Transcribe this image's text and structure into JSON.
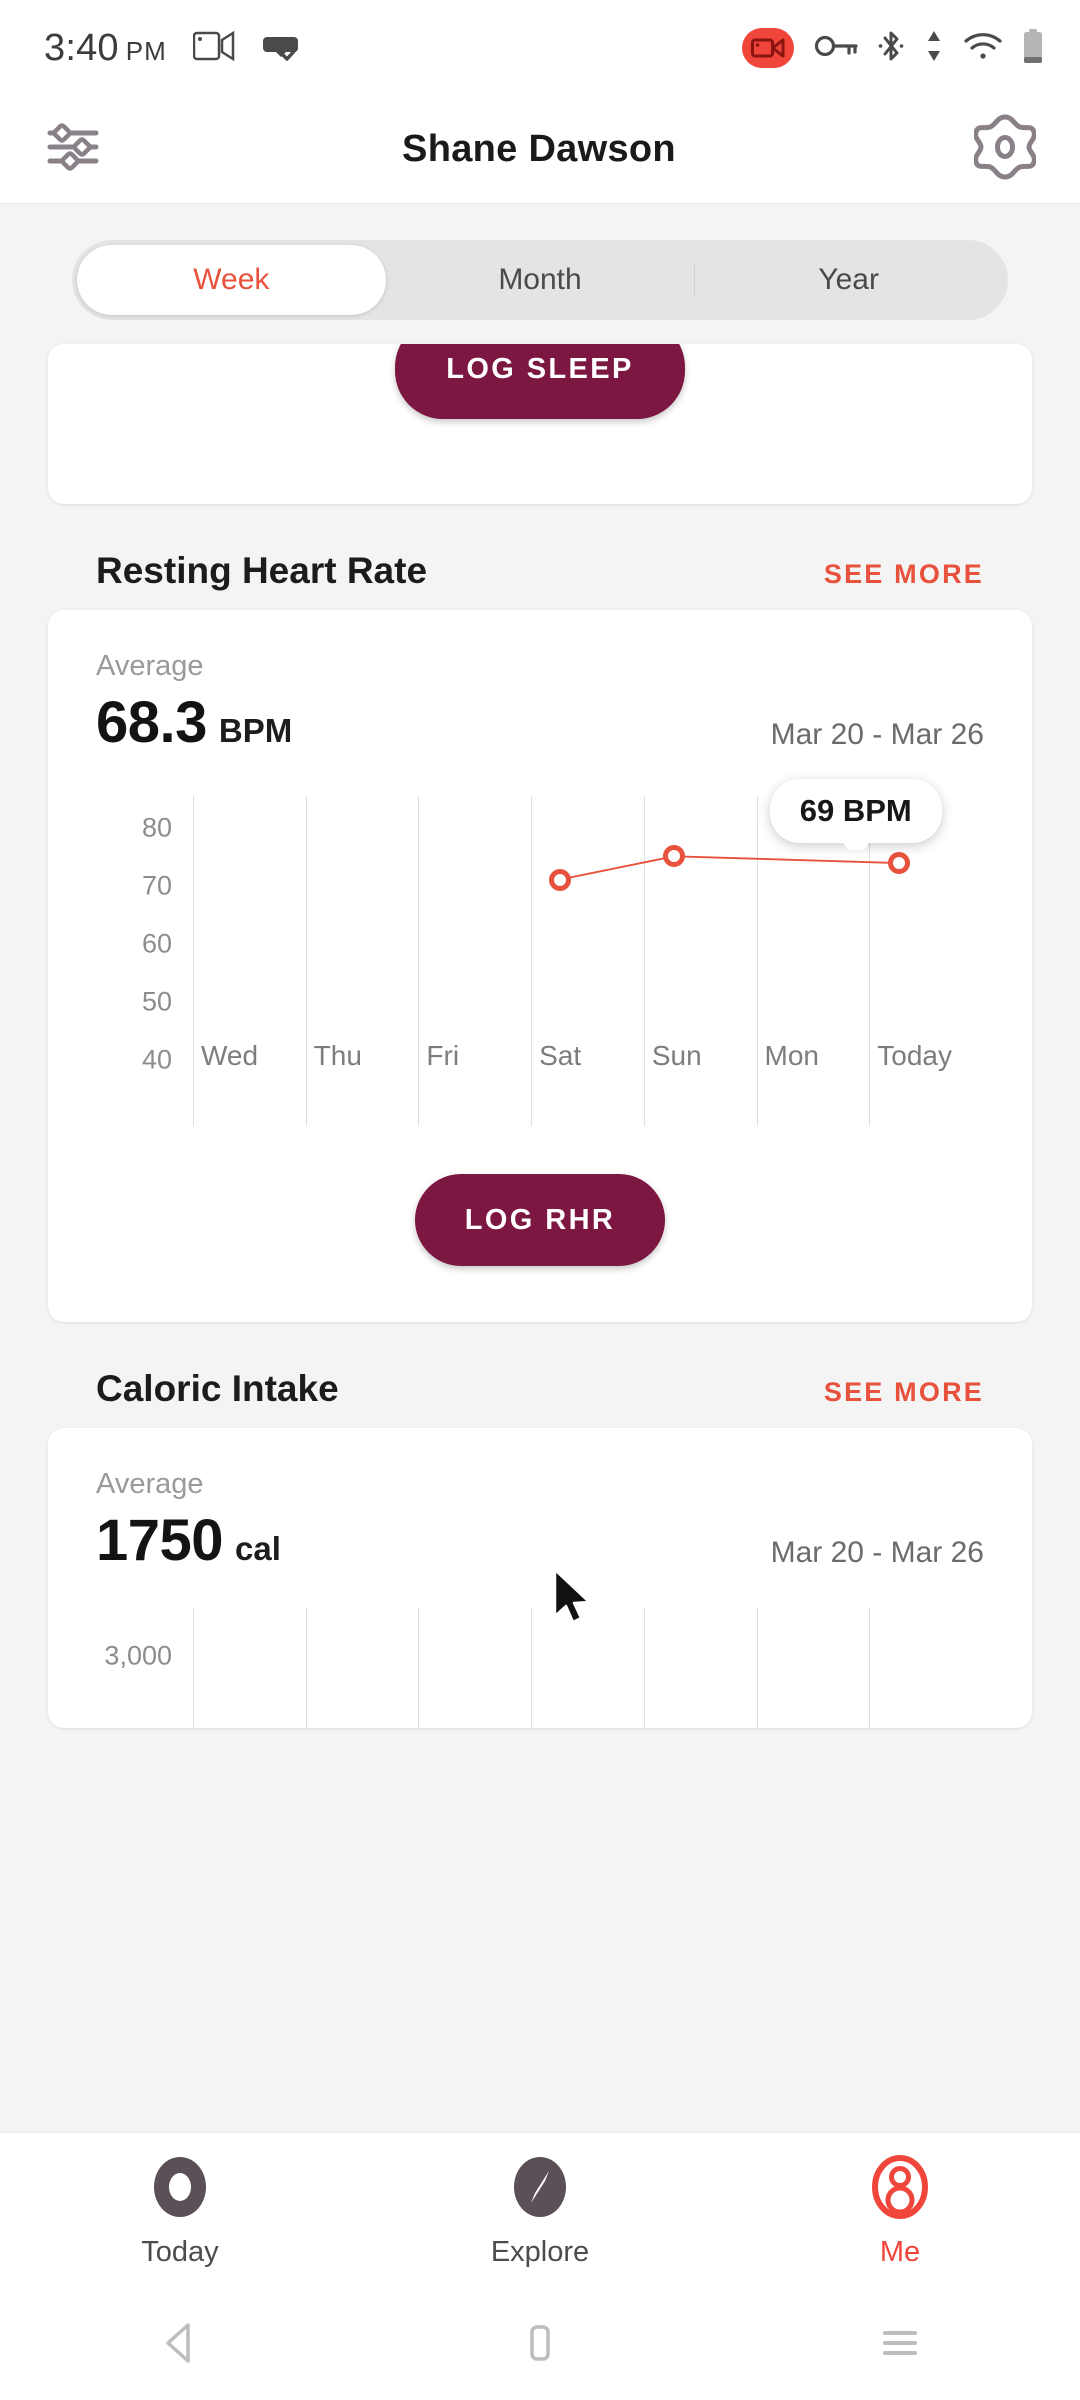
{
  "status_bar": {
    "time": "3:40",
    "ampm": "PM",
    "icons": [
      "cast-screen-icon",
      "vr-headset-check-icon",
      "screen-record-icon",
      "vpn-key-icon",
      "bluetooth-icon",
      "data-transfer-icon",
      "wifi-icon",
      "battery-icon"
    ]
  },
  "header": {
    "title": "Shane Dawson",
    "left_icon": "sliders-icon",
    "right_icon": "gear-icon"
  },
  "segment": {
    "options": [
      "Week",
      "Month",
      "Year"
    ],
    "selected": "Week",
    "active_color": "#e8513c"
  },
  "sleep_card": {
    "log_button": "LOG SLEEP"
  },
  "resting_heart_rate": {
    "section_title": "Resting Heart Rate",
    "see_more": "SEE MORE",
    "average_label": "Average",
    "average_value": "68.3",
    "average_unit": "BPM",
    "date_range": "Mar 20 - Mar 26",
    "log_button": "LOG RHR",
    "tooltip": "69 BPM"
  },
  "caloric_intake": {
    "section_title": "Caloric Intake",
    "see_more": "SEE MORE",
    "average_label": "Average",
    "average_value": "1750",
    "average_unit": "cal",
    "date_range": "Mar 20 - Mar 26",
    "y_top_label": "3,000"
  },
  "bottom_nav": {
    "items": [
      {
        "label": "Today",
        "icon": "donut-circle-icon",
        "active": false
      },
      {
        "label": "Explore",
        "icon": "compass-icon",
        "active": false
      },
      {
        "label": "Me",
        "icon": "person-icon",
        "active": true
      }
    ],
    "active_color": "#f0453a"
  },
  "android_nav": {
    "back": "back-triangle-icon",
    "home": "home-square-icon",
    "recents": "recents-lines-icon"
  },
  "chart_data": [
    {
      "type": "line",
      "title": "Resting Heart Rate",
      "xlabel": "",
      "ylabel": "BPM",
      "categories": [
        "Wed",
        "Thu",
        "Fri",
        "Sat",
        "Sun",
        "Mon",
        "Today"
      ],
      "values": [
        null,
        null,
        null,
        66,
        69.5,
        null,
        69
      ],
      "yticks": [
        80,
        70,
        60,
        50,
        40
      ],
      "ylim": [
        36,
        84
      ],
      "grid": true,
      "legend": "none",
      "annotations": [
        {
          "label": "69 BPM",
          "at": "Today"
        }
      ],
      "series_color": "#e8513c"
    },
    {
      "type": "bar",
      "title": "Caloric Intake",
      "xlabel": "",
      "ylabel": "cal",
      "categories": [
        "Wed",
        "Thu",
        "Fri",
        "Sat",
        "Sun",
        "Mon",
        "Today"
      ],
      "values": [
        null,
        null,
        null,
        null,
        null,
        null,
        null
      ],
      "yticks": [
        "3,000"
      ],
      "grid": true,
      "legend": "none",
      "note": "chart clipped at bottom of viewport"
    }
  ]
}
